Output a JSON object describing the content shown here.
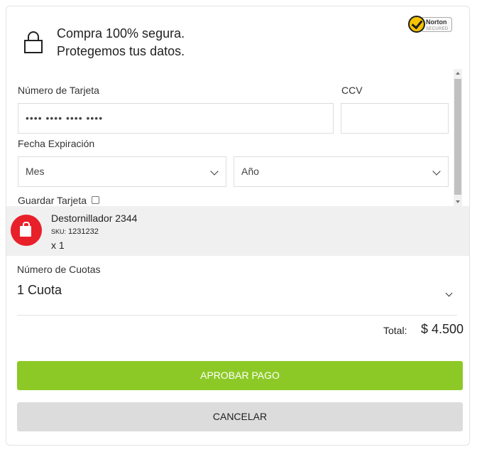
{
  "secure_banner": {
    "line1": "Compra 100% segura.",
    "line2": "Protegemos tus datos.",
    "badge_brand": "Norton",
    "badge_sub": "SECURED"
  },
  "form": {
    "card_number_label": "Número de Tarjeta",
    "card_number_value": "•••• •••• •••• ••••",
    "ccv_label": "CCV",
    "ccv_value": "",
    "expiry_label": "Fecha Expiración",
    "month_selected": "Mes",
    "year_selected": "Año",
    "save_card_label": "Guardar Tarjeta",
    "save_card_checked": false
  },
  "product": {
    "name": "Destornillador 2344",
    "sku_label": "SKU:",
    "sku": "1231232",
    "quantity": "x 1",
    "icon": "shopping-bag-icon",
    "icon_color": "#e8202a"
  },
  "installments": {
    "label": "Número de Cuotas",
    "selected": "1 Cuota"
  },
  "total": {
    "label": "Total:",
    "value": "$ 4.500"
  },
  "buttons": {
    "approve_label": "APROBAR PAGO",
    "cancel_label": "CANCELAR",
    "approve_color": "#8dc926",
    "cancel_color": "#dcdcdc"
  }
}
